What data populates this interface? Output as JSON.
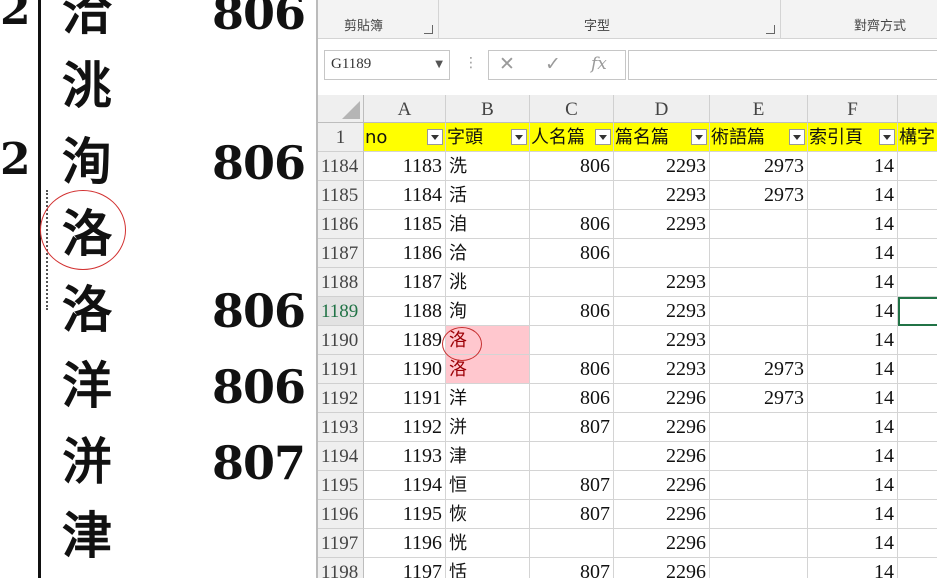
{
  "scan": {
    "rows": [
      {
        "num": "2",
        "char": "洽",
        "value": "806"
      },
      {
        "num": "",
        "char": "洮",
        "value": ""
      },
      {
        "num": "2",
        "char": "洵",
        "value": "806"
      },
      {
        "num": "",
        "char": "洛",
        "value": ""
      },
      {
        "num": "",
        "char": "洛",
        "value": "806"
      },
      {
        "num": "",
        "char": "洋",
        "value": "806"
      },
      {
        "num": "",
        "char": "洴",
        "value": "807"
      },
      {
        "num": "",
        "char": "津",
        "value": ""
      }
    ]
  },
  "ribbon": {
    "groups": [
      {
        "label": "剪貼簿"
      },
      {
        "label": "字型"
      },
      {
        "label": "對齊方式"
      }
    ]
  },
  "formula_bar": {
    "name_box": "G1189",
    "formula": ""
  },
  "columns": [
    "A",
    "B",
    "C",
    "D",
    "E",
    "F"
  ],
  "header_row": {
    "row_number": "1",
    "cells": [
      "no",
      "字頭",
      "人名篇",
      "篇名篇",
      "術語篇",
      "索引頁",
      "構字"
    ]
  },
  "rows": [
    {
      "r": "1184",
      "a": "1183",
      "b": "洗",
      "c": "806",
      "d": "2293",
      "e": "2973",
      "f": "14"
    },
    {
      "r": "1185",
      "a": "1184",
      "b": "活",
      "c": "",
      "d": "2293",
      "e": "2973",
      "f": "14"
    },
    {
      "r": "1186",
      "a": "1185",
      "b": "洎",
      "c": "806",
      "d": "2293",
      "e": "",
      "f": "14"
    },
    {
      "r": "1187",
      "a": "1186",
      "b": "洽",
      "c": "806",
      "d": "",
      "e": "",
      "f": "14"
    },
    {
      "r": "1188",
      "a": "1187",
      "b": "洮",
      "c": "",
      "d": "2293",
      "e": "",
      "f": "14"
    },
    {
      "r": "1189",
      "a": "1188",
      "b": "洵",
      "c": "806",
      "d": "2293",
      "e": "",
      "f": "14"
    },
    {
      "r": "1190",
      "a": "1189",
      "b": "洛",
      "c": "",
      "d": "2293",
      "e": "",
      "f": "14"
    },
    {
      "r": "1191",
      "a": "1190",
      "b": "洛",
      "c": "806",
      "d": "2293",
      "e": "2973",
      "f": "14"
    },
    {
      "r": "1192",
      "a": "1191",
      "b": "洋",
      "c": "806",
      "d": "2296",
      "e": "2973",
      "f": "14"
    },
    {
      "r": "1193",
      "a": "1192",
      "b": "洴",
      "c": "807",
      "d": "2296",
      "e": "",
      "f": "14"
    },
    {
      "r": "1194",
      "a": "1193",
      "b": "津",
      "c": "",
      "d": "2296",
      "e": "",
      "f": "14"
    },
    {
      "r": "1195",
      "a": "1194",
      "b": "恒",
      "c": "807",
      "d": "2296",
      "e": "",
      "f": "14"
    },
    {
      "r": "1196",
      "a": "1195",
      "b": "恢",
      "c": "807",
      "d": "2296",
      "e": "",
      "f": "14"
    },
    {
      "r": "1197",
      "a": "1196",
      "b": "恍",
      "c": "",
      "d": "2296",
      "e": "",
      "f": "14"
    },
    {
      "r": "1198",
      "a": "1197",
      "b": "恬",
      "c": "807",
      "d": "2296",
      "e": "",
      "f": "14"
    }
  ],
  "colors": {
    "highlight_fill": "#ffc7ce",
    "highlight_text": "#9c0006",
    "header_fill": "#ffff00",
    "annotation_circle": "#d23030",
    "selection": "#217346"
  }
}
